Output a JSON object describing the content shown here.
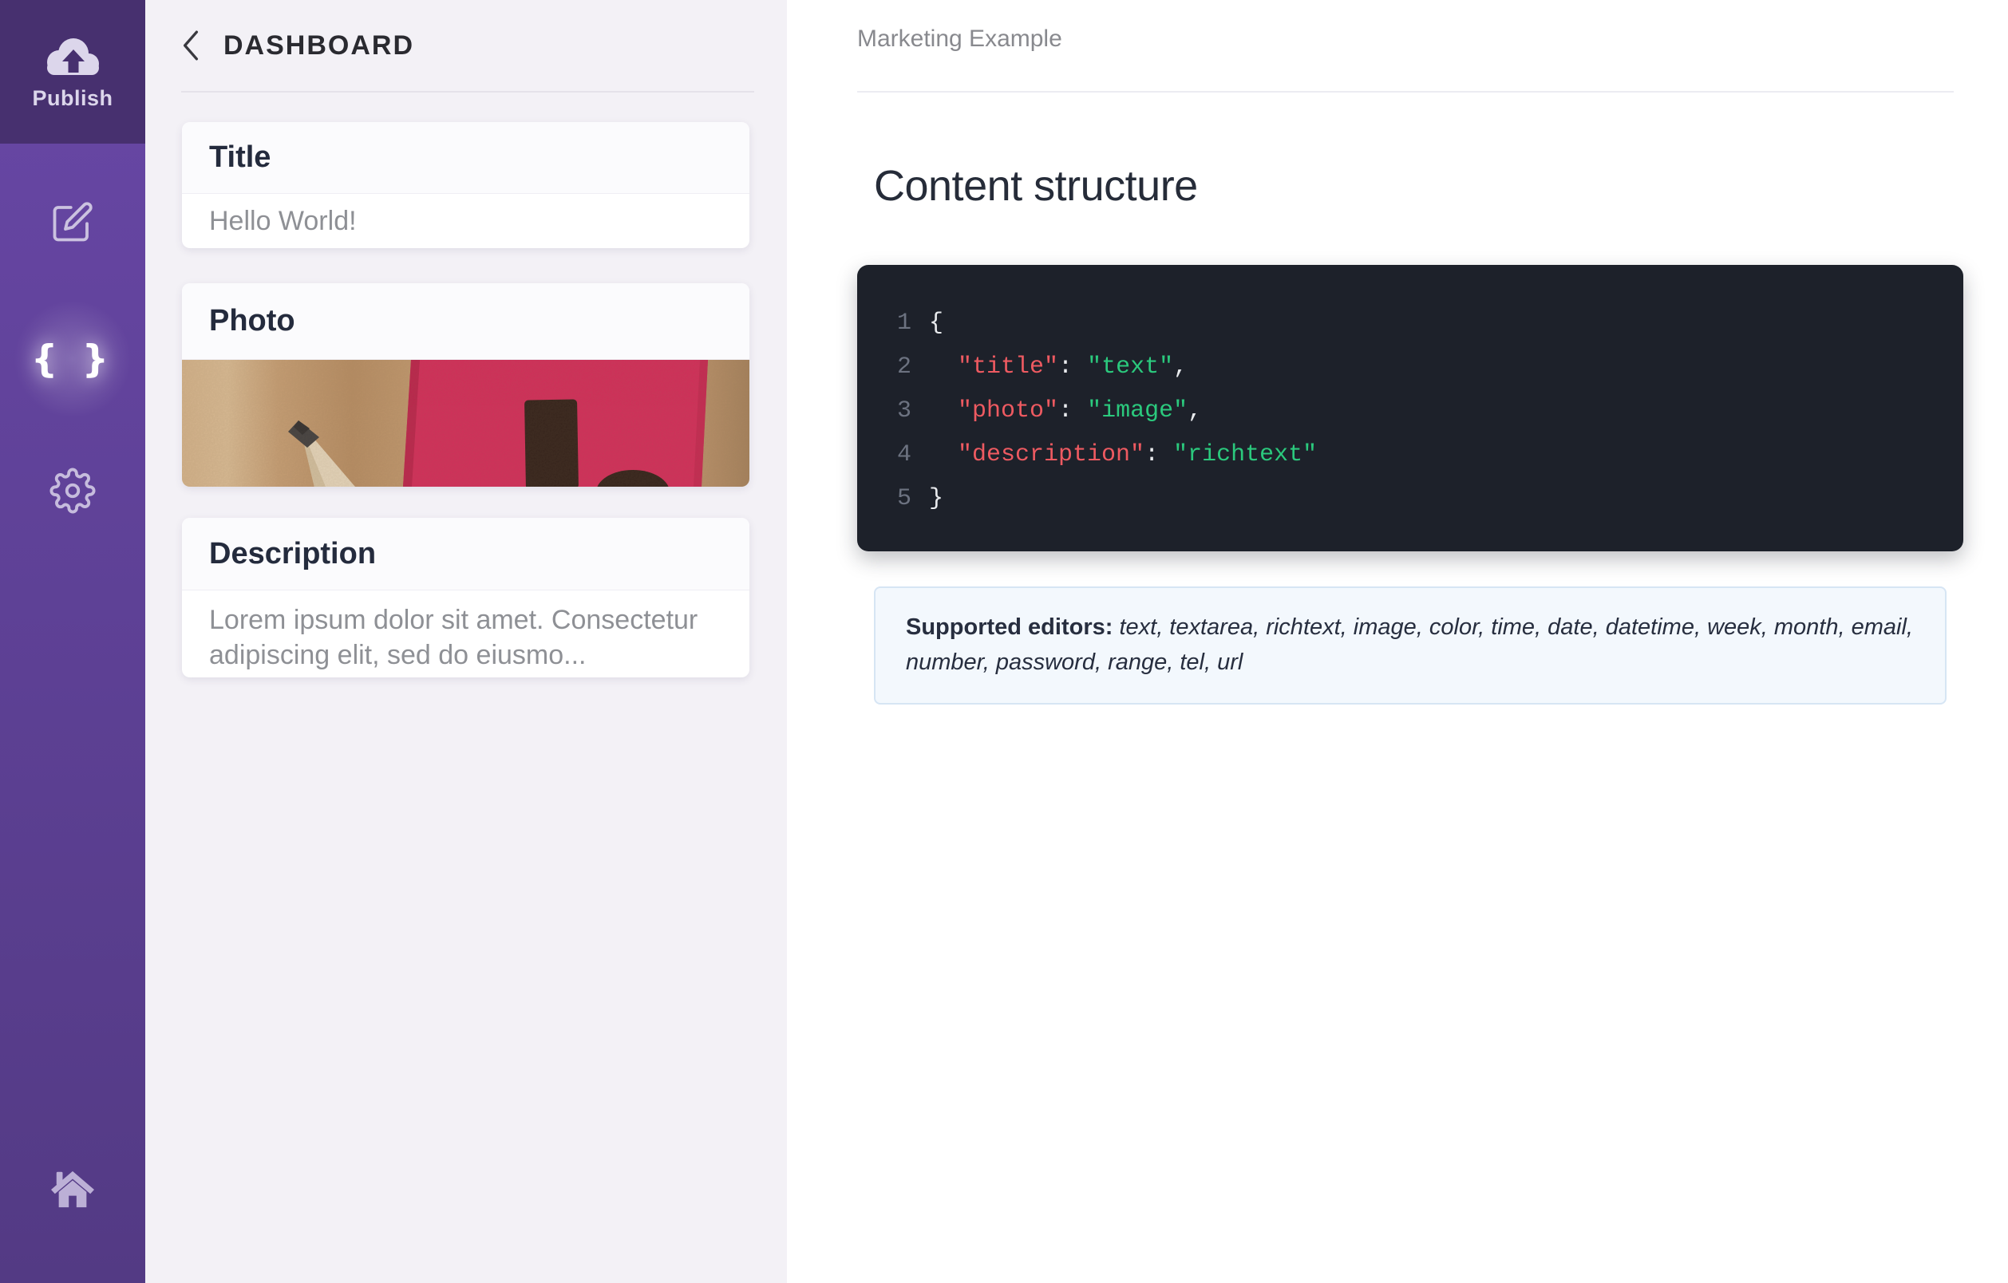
{
  "colors": {
    "sidebar_top": "#47306F",
    "sidebar_gradient_start": "#6847A6",
    "sidebar_gradient_end": "#533A84",
    "sidebar_icon": "#CBC2E0",
    "publish_foreground": "#DCD6EB",
    "panel_background": "#F3F1F6",
    "code_background": "#1D212A",
    "code_key": "#EE5A61",
    "code_value": "#2BC97D",
    "info_background": "#F3F8FD",
    "info_border": "#D6E5F4",
    "photo_pink": "#D62A5B"
  },
  "sidebar": {
    "publish_label": "Publish",
    "nav": [
      {
        "icon": "edit-icon",
        "active": false
      },
      {
        "icon": "code-braces-icon",
        "active": true,
        "glyph": "{ }"
      },
      {
        "icon": "settings-gear-icon",
        "active": false
      },
      {
        "icon": "home-icon",
        "active": false
      }
    ]
  },
  "panel": {
    "back_label": "DASHBOARD",
    "cards": [
      {
        "title": "Title",
        "value": "Hello World!"
      },
      {
        "title": "Photo"
      },
      {
        "title": "Description",
        "value": "Lorem ipsum dolor sit amet. Consectetur adipiscing elit, sed do eiusmo..."
      }
    ]
  },
  "main": {
    "breadcrumb": "Marketing Example",
    "heading": "Content structure",
    "code": {
      "lines": [
        {
          "n": "1",
          "tokens": [
            {
              "text": "{",
              "type": "punct"
            }
          ]
        },
        {
          "n": "2",
          "tokens": [
            {
              "text": "  ",
              "type": "punct"
            },
            {
              "text": "\"title\"",
              "type": "key"
            },
            {
              "text": ": ",
              "type": "punct"
            },
            {
              "text": "\"text\"",
              "type": "value"
            },
            {
              "text": ",",
              "type": "punct"
            }
          ]
        },
        {
          "n": "3",
          "tokens": [
            {
              "text": "  ",
              "type": "punct"
            },
            {
              "text": "\"photo\"",
              "type": "key"
            },
            {
              "text": ": ",
              "type": "punct"
            },
            {
              "text": "\"image\"",
              "type": "value"
            },
            {
              "text": ",",
              "type": "punct"
            }
          ]
        },
        {
          "n": "4",
          "tokens": [
            {
              "text": "  ",
              "type": "punct"
            },
            {
              "text": "\"description\"",
              "type": "key"
            },
            {
              "text": ": ",
              "type": "punct"
            },
            {
              "text": "\"richtext\"",
              "type": "value"
            }
          ]
        },
        {
          "n": "5",
          "tokens": [
            {
              "text": "}",
              "type": "punct"
            }
          ]
        }
      ]
    },
    "info": {
      "label": "Supported editors:",
      "editors": "text, textarea, richtext, image, color, time, date, datetime, week, month, email, number, password, range, tel, url"
    }
  }
}
